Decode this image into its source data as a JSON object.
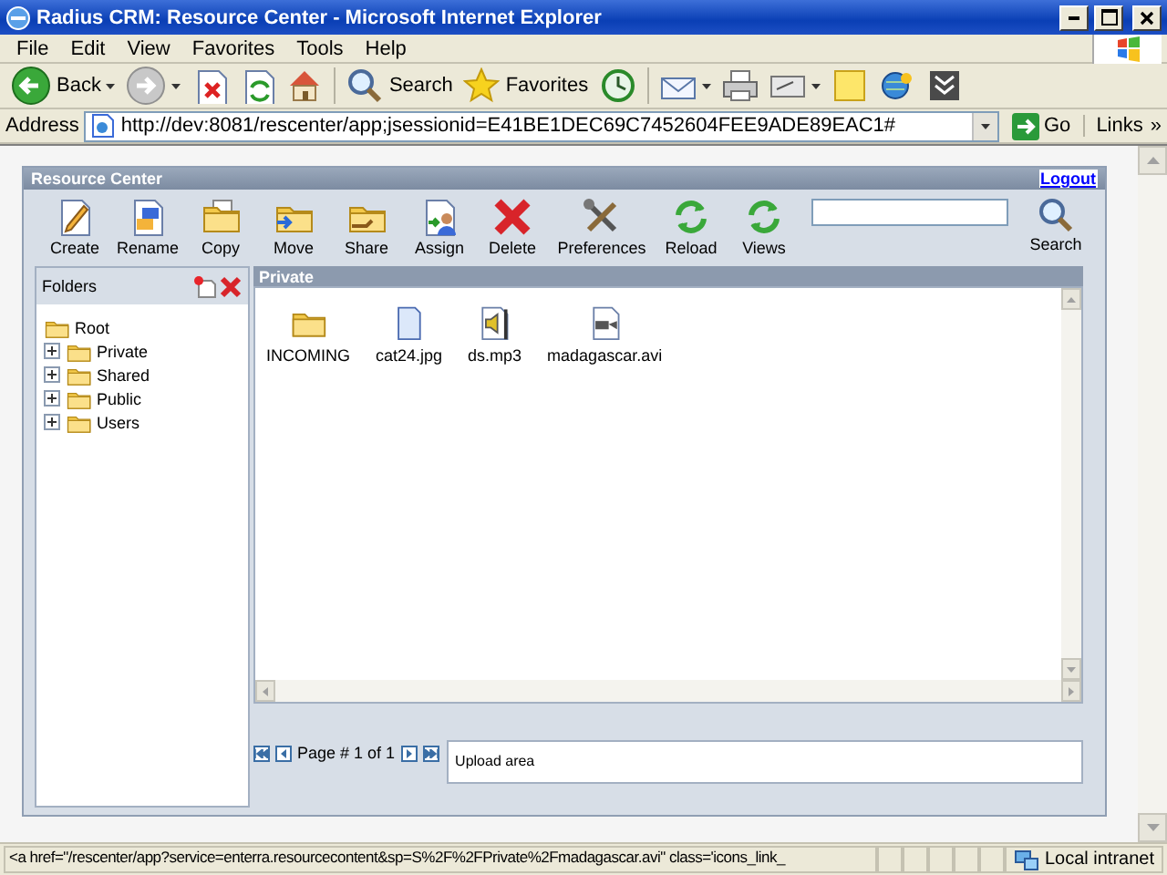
{
  "window": {
    "title": "Radius CRM: Resource Center - Microsoft Internet Explorer"
  },
  "menu": [
    {
      "label": "File"
    },
    {
      "label": "Edit"
    },
    {
      "label": "View"
    },
    {
      "label": "Favorites"
    },
    {
      "label": "Tools"
    },
    {
      "label": "Help"
    }
  ],
  "toolbar": [
    {
      "kind": "back",
      "label": "Back",
      "dropdown": true
    },
    {
      "kind": "forward",
      "dropdown": true
    },
    {
      "kind": "stop",
      "dropdown": false
    },
    {
      "kind": "refresh",
      "dropdown": false
    },
    {
      "kind": "home",
      "dropdown": false
    },
    {
      "kind": "search",
      "label": "Search",
      "dropdown": false
    },
    {
      "kind": "favorites",
      "label": "Favorites",
      "dropdown": false
    },
    {
      "kind": "history",
      "dropdown": false
    },
    {
      "kind": "mail",
      "dropdown": true
    },
    {
      "kind": "print",
      "dropdown": false
    },
    {
      "kind": "edit",
      "dropdown": true
    },
    {
      "kind": "note",
      "dropdown": false
    },
    {
      "kind": "messenger",
      "dropdown": false
    },
    {
      "kind": "research",
      "dropdown": false
    }
  ],
  "address": {
    "label": "Address",
    "value": "http://dev:8081/rescenter/app;jsessionid=E41BE1DEC69C7452604FEE9ADE89EAC1#",
    "go": "Go",
    "links": "Links",
    "more": "»"
  },
  "app": {
    "title": "Resource Center",
    "logout": "Logout",
    "actions": [
      {
        "kind": "create",
        "label": "Create"
      },
      {
        "kind": "rename",
        "label": "Rename"
      },
      {
        "kind": "copy",
        "label": "Copy"
      },
      {
        "kind": "move",
        "label": "Move"
      },
      {
        "kind": "share",
        "label": "Share"
      },
      {
        "kind": "assign",
        "label": "Assign"
      },
      {
        "kind": "delete",
        "label": "Delete"
      },
      {
        "kind": "preferences",
        "label": "Preferences"
      },
      {
        "kind": "reload",
        "label": "Reload"
      },
      {
        "kind": "views",
        "label": "Views"
      }
    ],
    "search": {
      "label": "Search"
    },
    "folders": {
      "title": "Folders",
      "tree": [
        {
          "label": "Root",
          "children": [
            {
              "label": "Private",
              "expanded": false
            },
            {
              "label": "Shared",
              "expanded": false
            },
            {
              "label": "Public",
              "expanded": false
            },
            {
              "label": "Users",
              "expanded": false
            }
          ]
        }
      ]
    },
    "content": {
      "title": "Private",
      "files": [
        {
          "kind": "folder",
          "name": "INCOMING"
        },
        {
          "kind": "image",
          "name": "cat24.jpg"
        },
        {
          "kind": "audio",
          "name": "ds.mp3"
        },
        {
          "kind": "video",
          "name": "madagascar.avi"
        }
      ]
    },
    "pager": {
      "text": "Page # 1 of 1"
    },
    "upload": {
      "text": "Upload area"
    }
  },
  "status_bar": {
    "text": "<a href=\"/rescenter/app?service=enterra.resourcecontent&sp=S%2F%2FPrivate%2Fmadagascar.avi\" class='icons_link_",
    "zone": "Local intranet"
  }
}
